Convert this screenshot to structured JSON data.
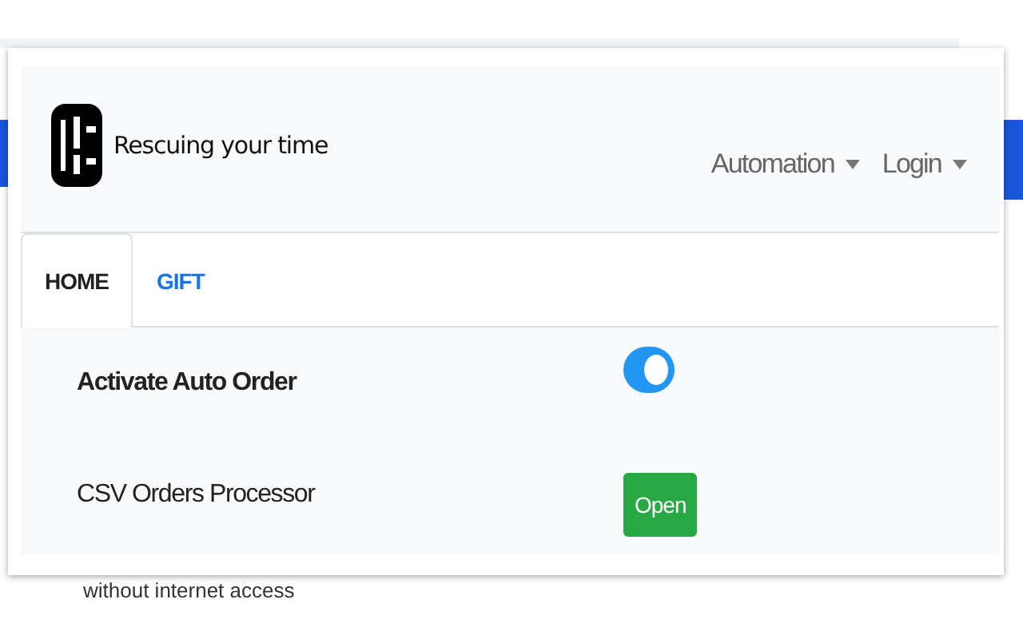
{
  "brand": {
    "tagline": "Rescuing your time"
  },
  "nav": [
    {
      "label": "Automation"
    },
    {
      "label": "Login"
    }
  ],
  "tabs": [
    {
      "label": "HOME",
      "selected": true
    },
    {
      "label": "GIFT",
      "selected": false
    }
  ],
  "rows": [
    {
      "kind": "toggle",
      "label": "Activate Auto Order",
      "on": true
    },
    {
      "kind": "button",
      "label": "CSV Orders Processor",
      "button": "Open"
    }
  ],
  "background": {
    "text": "without internet access"
  }
}
